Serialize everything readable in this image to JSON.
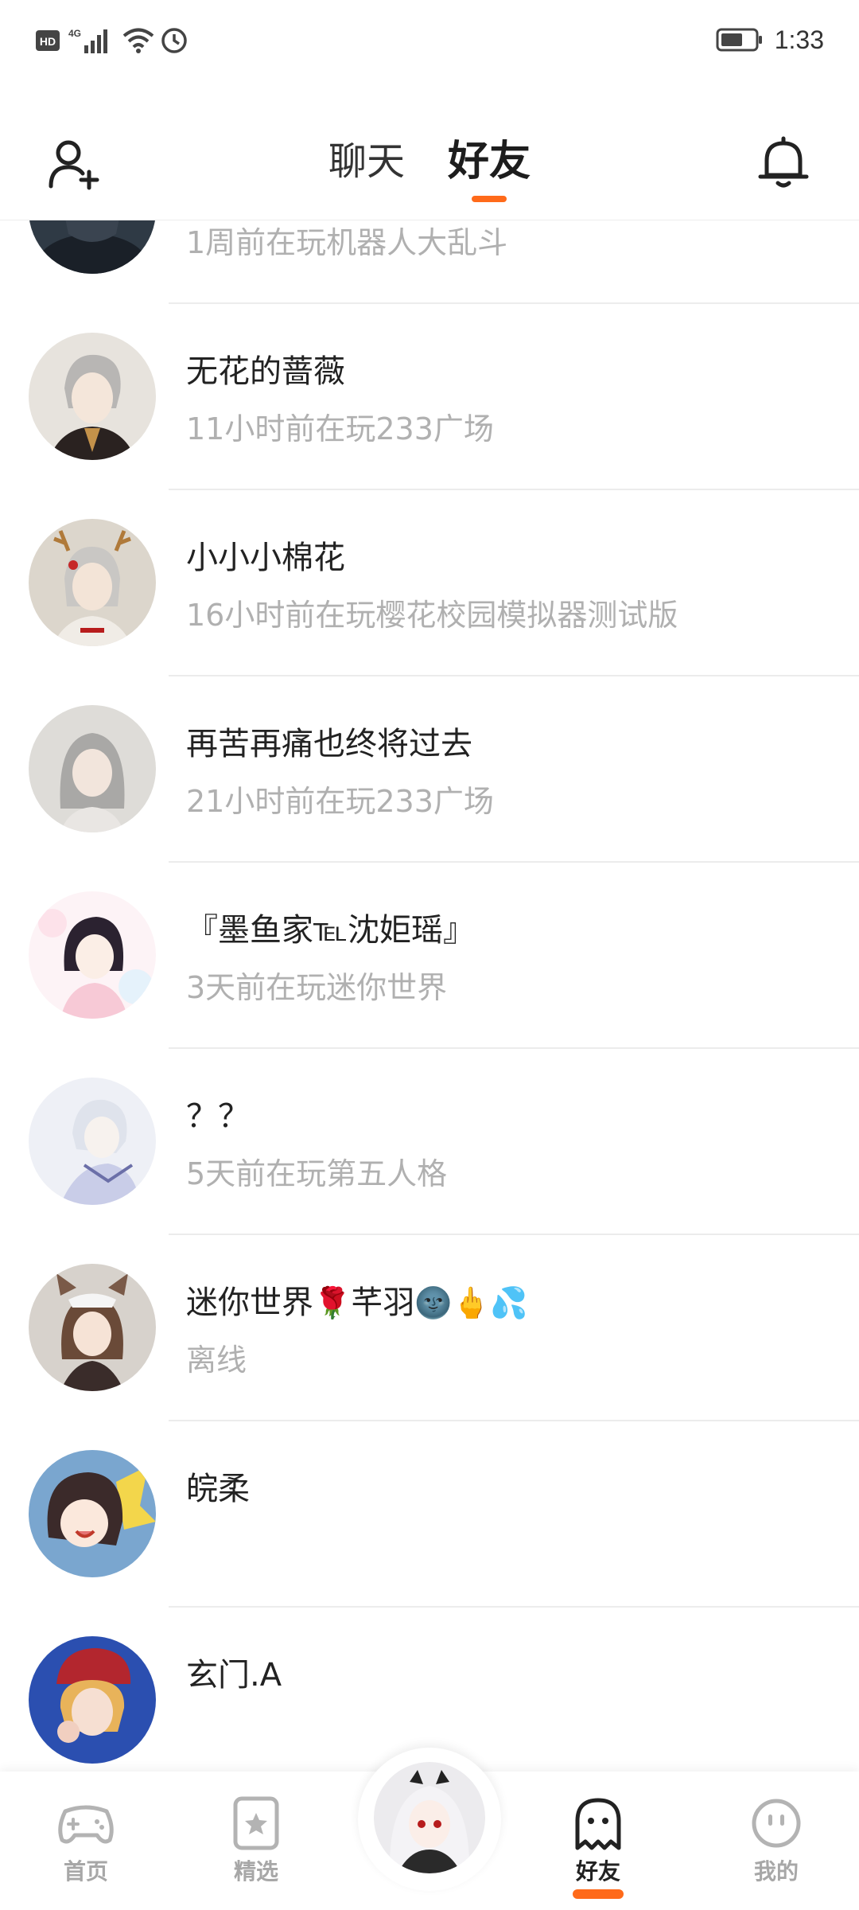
{
  "status_bar": {
    "network_badge": "HD",
    "signal_type": "4G",
    "time": "1:33",
    "icons": [
      "hd-icon",
      "signal-icon",
      "wifi-icon",
      "timer-icon",
      "battery-icon"
    ]
  },
  "header": {
    "tabs": [
      {
        "label": "聊天",
        "active": false
      },
      {
        "label": "好友",
        "active": true
      }
    ],
    "left_icon": "add-friend-icon",
    "right_icon": "bell-icon",
    "accent_color": "#ff6a1a"
  },
  "friends": [
    {
      "name": "",
      "status": "1周前在玩机器人大乱斗"
    },
    {
      "name": "无花的蔷薇",
      "status": "11小时前在玩233广场"
    },
    {
      "name": "小小小棉花",
      "status": "16小时前在玩樱花校园模拟器测试版"
    },
    {
      "name": "再苦再痛也终将过去",
      "status": "21小时前在玩233广场"
    },
    {
      "name": "『墨鱼家℡沈姖瑶』",
      "status": "3天前在玩迷你世界"
    },
    {
      "name": "？？",
      "status": "5天前在玩第五人格"
    },
    {
      "name": "迷你世界",
      "name_emojis": [
        "🌹",
        "芊羽",
        "🌚",
        "🖕",
        "💦"
      ],
      "status": "离线"
    },
    {
      "name": "皖柔",
      "status": ""
    },
    {
      "name": "玄门.A",
      "status": ""
    }
  ],
  "bottom_nav": {
    "items": [
      {
        "label": "首页",
        "icon": "gamepad-icon",
        "active": false
      },
      {
        "label": "精选",
        "icon": "star-card-icon",
        "active": false
      },
      {
        "label": "",
        "icon": "center-avatar",
        "active": false
      },
      {
        "label": "好友",
        "icon": "ghost-icon",
        "active": true
      },
      {
        "label": "我的",
        "icon": "smiley-icon",
        "active": false
      }
    ]
  }
}
